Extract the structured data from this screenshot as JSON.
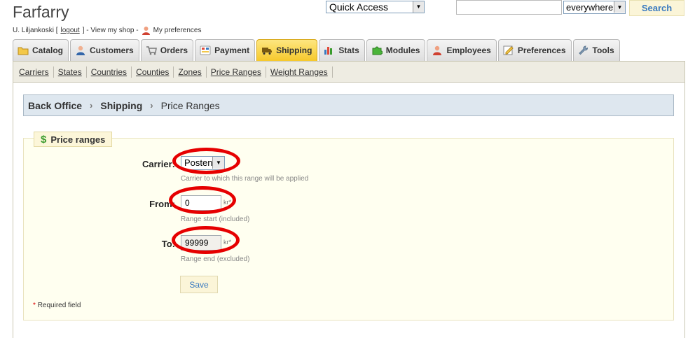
{
  "shop": {
    "title": "Farfarry"
  },
  "user": {
    "name": "U. Liljankoski [",
    "logout": "logout",
    "after_logout": "] - View my shop -",
    "preferences": "My preferences"
  },
  "header": {
    "quick_access": "Quick Access",
    "search_value": "",
    "scope": "everywhere",
    "search_button": "Search"
  },
  "tabs": [
    {
      "label": "Catalog",
      "icon": "folder-icon"
    },
    {
      "label": "Customers",
      "icon": "customer-icon"
    },
    {
      "label": "Orders",
      "icon": "cart-icon"
    },
    {
      "label": "Payment",
      "icon": "payment-icon"
    },
    {
      "label": "Shipping",
      "icon": "truck-icon",
      "active": true
    },
    {
      "label": "Stats",
      "icon": "chart-icon"
    },
    {
      "label": "Modules",
      "icon": "puzzle-icon"
    },
    {
      "label": "Employees",
      "icon": "employee-icon"
    },
    {
      "label": "Preferences",
      "icon": "preferences-icon"
    },
    {
      "label": "Tools",
      "icon": "wrench-icon"
    }
  ],
  "subnav": [
    "Carriers",
    "States",
    "Countries",
    "Counties",
    "Zones",
    "Price Ranges",
    "Weight Ranges"
  ],
  "breadcrumb": {
    "root": "Back Office",
    "section": "Shipping",
    "page": "Price Ranges"
  },
  "form": {
    "legend": "Price ranges",
    "carrier_label": "Carrier:",
    "carrier_value": "Posten",
    "carrier_hint": "Carrier to which this range will be applied",
    "from_label": "From:",
    "from_value": "0",
    "from_unit": "kr*",
    "from_hint": "Range start (included)",
    "to_label": "To:",
    "to_value": "99999",
    "to_unit": "kr*",
    "to_hint": "Range end (excluded)",
    "save": "Save",
    "required_star": "*",
    "required_text": "Required field"
  },
  "colors": {
    "accent_tab": "#f6c92c",
    "link": "#3a7ac0",
    "highlight_circle": "#e60000"
  }
}
